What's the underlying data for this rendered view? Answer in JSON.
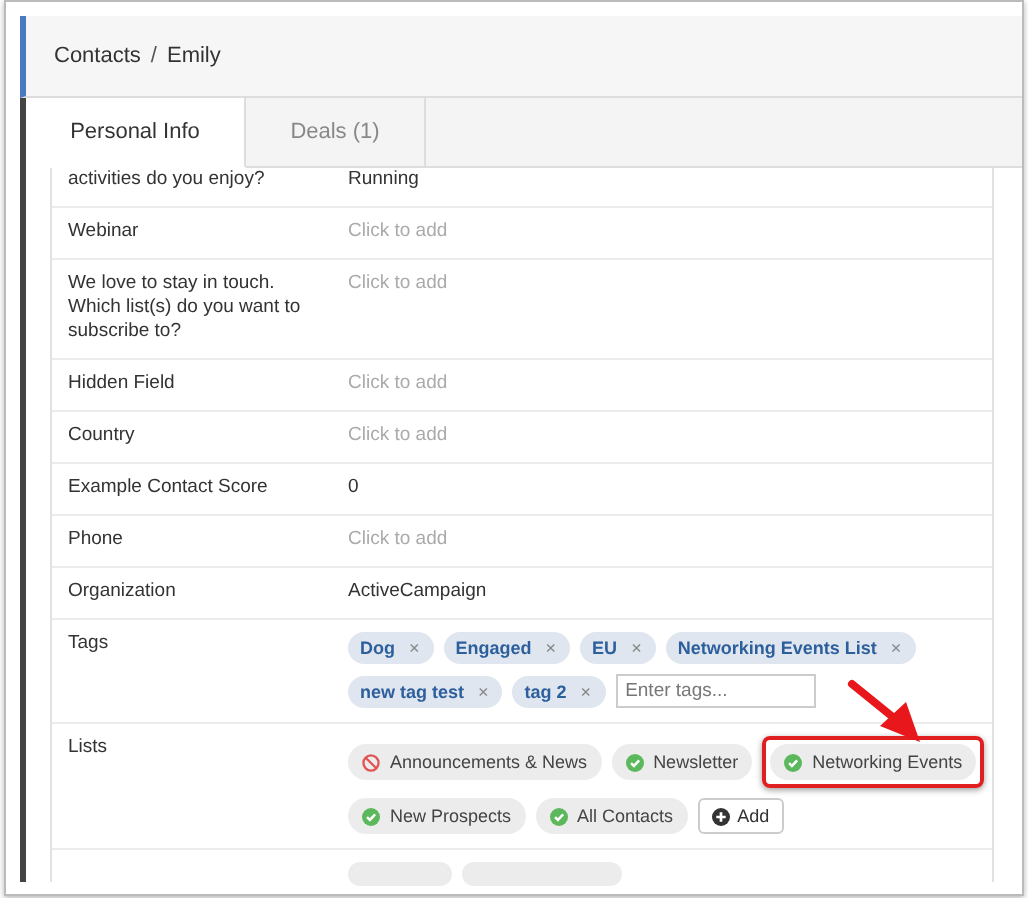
{
  "breadcrumb": {
    "parent": "Contacts",
    "separator": "/",
    "current": "Emily"
  },
  "tabs": [
    {
      "label": "Personal Info",
      "selected": true
    },
    {
      "label": "Deals (1)",
      "selected": false
    }
  ],
  "fields": [
    {
      "kind": "text",
      "label": "activities do you enjoy?",
      "value": "Running"
    },
    {
      "kind": "text",
      "label": "Webinar",
      "placeholder": "Click to add"
    },
    {
      "kind": "text",
      "label": "We love to stay in touch. Which list(s) do you want to subscribe to?",
      "placeholder": "Click to add"
    },
    {
      "kind": "text",
      "label": "Hidden Field",
      "placeholder": "Click to add"
    },
    {
      "kind": "text",
      "label": "Country",
      "placeholder": "Click to add"
    },
    {
      "kind": "text",
      "label": "Example Contact Score",
      "value": "0"
    },
    {
      "kind": "text",
      "label": "Phone",
      "placeholder": "Click to add"
    },
    {
      "kind": "text",
      "label": "Organization",
      "value": "ActiveCampaign"
    },
    {
      "kind": "tags",
      "label": "Tags",
      "tags": [
        {
          "name": "Dog",
          "remove": "×"
        },
        {
          "name": "Engaged",
          "remove": "×"
        },
        {
          "name": "EU",
          "remove": "×"
        },
        {
          "name": "Networking Events List",
          "remove": "×"
        },
        {
          "name": "new tag test",
          "remove": "×"
        },
        {
          "name": "tag 2",
          "remove": "×"
        }
      ],
      "placeholder": "Enter tags..."
    },
    {
      "kind": "lists",
      "label": "Lists",
      "lists": [
        {
          "name": "Announcements & News",
          "subscribed": false,
          "highlighted": false
        },
        {
          "name": "Newsletter",
          "subscribed": true,
          "highlighted": false
        },
        {
          "name": "Networking Events",
          "subscribed": true,
          "highlighted": true
        },
        {
          "name": "New Prospects",
          "subscribed": true,
          "highlighted": false
        },
        {
          "name": "All Contacts",
          "subscribed": true,
          "highlighted": false
        }
      ],
      "add_button": "Add"
    }
  ]
}
